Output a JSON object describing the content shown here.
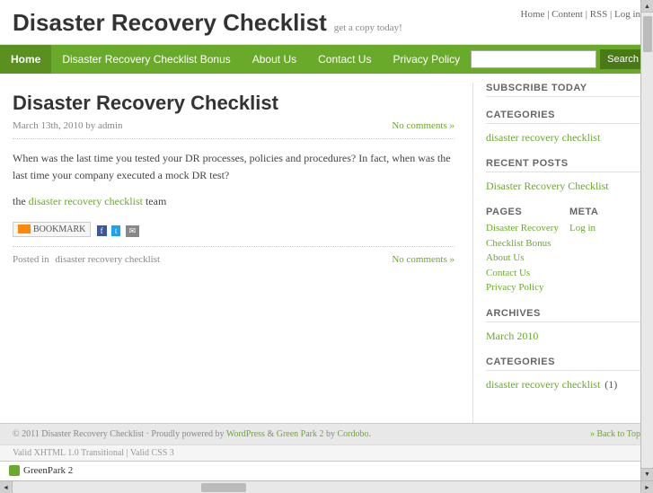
{
  "browser": {
    "scrollbar_up": "▲",
    "scrollbar_down": "▼",
    "scrollbar_left": "◄",
    "scrollbar_right": "►"
  },
  "header": {
    "site_title": "Disaster Recovery Checklist",
    "site_tagline": "get a copy today!",
    "nav_links": "Home | Content | RSS | Log in"
  },
  "nav": {
    "items": [
      {
        "label": "Home"
      },
      {
        "label": "Disaster Recovery Checklist Bonus"
      },
      {
        "label": "About Us"
      },
      {
        "label": "Contact Us"
      },
      {
        "label": "Privacy Policy"
      }
    ],
    "search_placeholder": "",
    "search_button": "Search"
  },
  "post": {
    "title": "Disaster Recovery Checklist",
    "meta_date": "March 13th, 2010 by admin",
    "meta_comments": "No comments »",
    "body_p1": "When was the last time you tested your DR processes, policies and procedures? In fact, when was the last time your company executed a mock DR test?",
    "body_team_prefix": "the ",
    "body_team_link": "disaster recovery checklist",
    "body_team_suffix": " team",
    "bookmark_label": "BOOKMARK",
    "footer_posted": "Posted in",
    "footer_category": "disaster recovery checklist",
    "footer_comments": "No comments »"
  },
  "sidebar": {
    "subscribe_title": "SUBSCRIBE TODAY",
    "categories_title": "CATEGORIES",
    "categories_link": "disaster recovery checklist",
    "recent_posts_title": "RECENT POSTS",
    "recent_post_link": "Disaster Recovery Checklist",
    "pages_title": "PAGES",
    "pages_items": [
      {
        "label": "Disaster Recovery Checklist Bonus"
      },
      {
        "label": "About Us"
      },
      {
        "label": "Contact Us"
      },
      {
        "label": "Privacy Policy"
      }
    ],
    "meta_title": "META",
    "meta_items": [
      {
        "label": "Log in"
      }
    ],
    "archives_title": "ARCHIVES",
    "archives_link": "March 2010",
    "categories2_title": "CATEGORIES",
    "categories2_link": "disaster recovery checklist",
    "categories2_count": "(1)"
  },
  "footer": {
    "copyright": "© 2011 Disaster Recovery Checklist · Proudly powered by ",
    "wp_link": "WordPress",
    "amp": " & ",
    "theme_link": "Green Park 2",
    "by": " by ",
    "author_link": "Cordobo.",
    "back_to_top": "» Back to Top",
    "valid_line": "Valid XHTML 1.0 Transitional | Valid CSS 3"
  },
  "bottom_bar": {
    "label": "GreenPark 2"
  }
}
